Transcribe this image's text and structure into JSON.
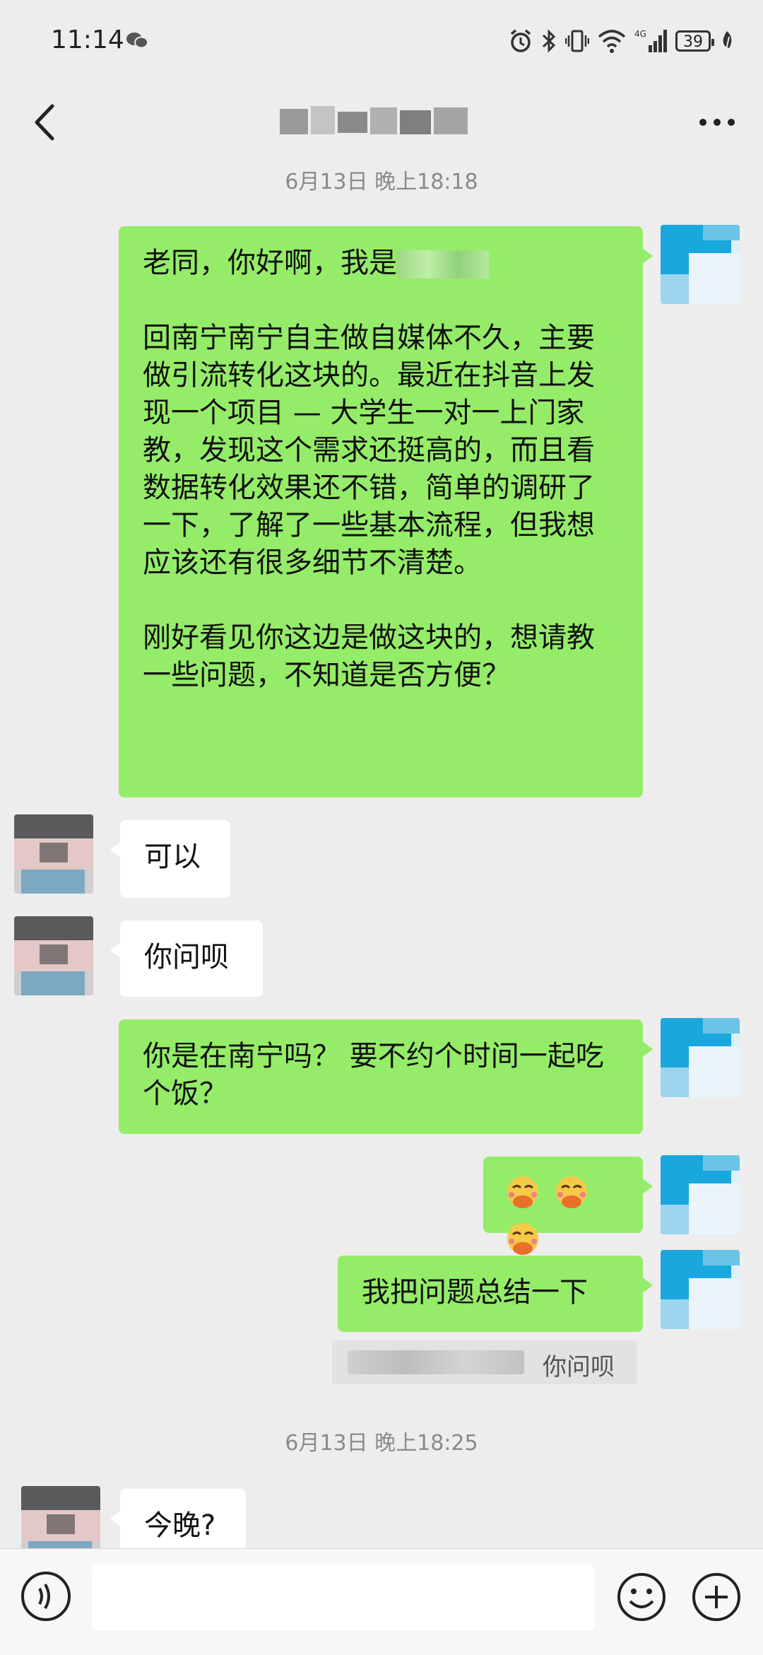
{
  "status_bar": {
    "time": "11:14",
    "battery": "39",
    "network": "4G"
  },
  "header": {
    "title_blurred": true
  },
  "timestamps": [
    "6月13日 晚上18:18",
    "6月13日 晚上18:25"
  ],
  "messages": [
    {
      "sender": "me",
      "paragraphs": [
        "老同，你好啊，我是",
        "回南宁南宁自主做自媒体不久，主要做引流转化这块的。最近在抖音上发现一个项目 — 大学生一对一上门家教，发现这个需求还挺高的，而且看数据转化效果还不错，简单的调研了一下，了解了一些基本流程，但我想应该还有很多细节不清楚。",
        "刚好看见你这边是做这块的，想请教一些问题，不知道是否方便？"
      ]
    },
    {
      "sender": "other",
      "text": "可以"
    },
    {
      "sender": "other",
      "text": "你问呗"
    },
    {
      "sender": "me",
      "text": "你是在南宁吗？ 要不约个时间一起吃个饭？"
    },
    {
      "sender": "me",
      "emoji": [
        "face-with-hand-over-mouth",
        "face-with-hand-over-mouth",
        "face-with-hand-over-mouth"
      ]
    },
    {
      "sender": "me",
      "text": "我把问题总结一下",
      "quote": {
        "text": "你问呗"
      }
    },
    {
      "sender": "other",
      "text": "今晚?"
    }
  ],
  "input": {
    "placeholder": ""
  },
  "colors": {
    "my_bubble": "#95ec69",
    "their_bubble": "#ffffff",
    "background": "#ededed"
  }
}
